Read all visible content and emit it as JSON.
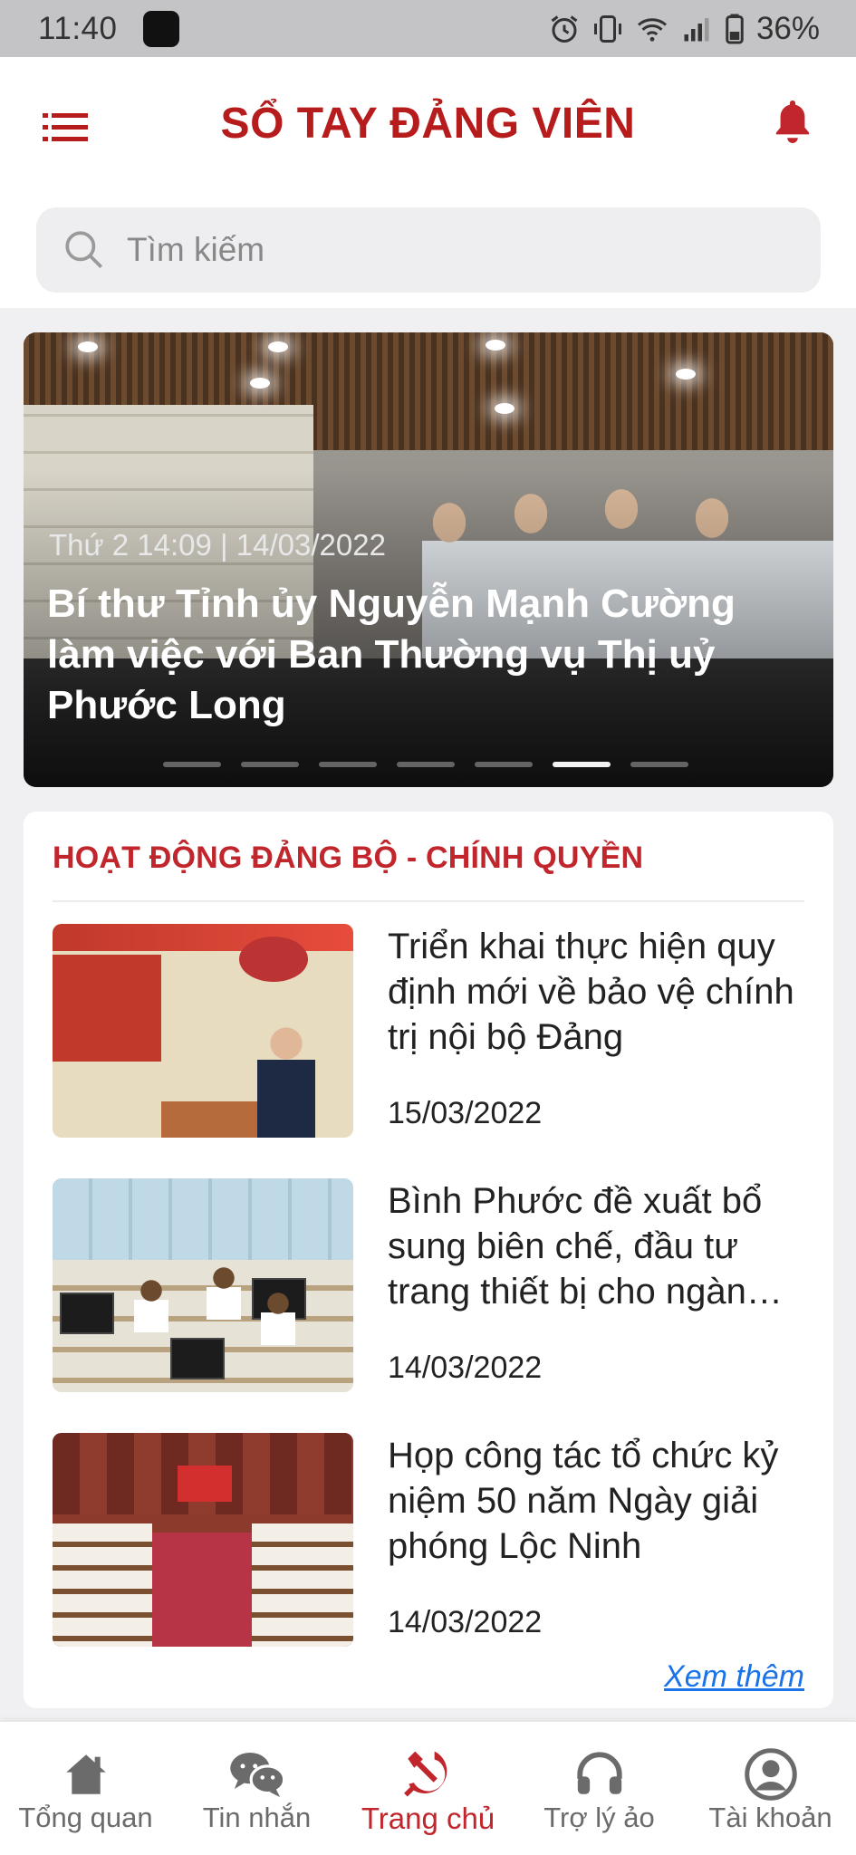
{
  "status_bar": {
    "time": "11:40",
    "battery": "36%",
    "icons": [
      "app-icon",
      "alarm-icon",
      "vibrate-icon",
      "wifi-icon",
      "signal-icon",
      "battery-icon"
    ]
  },
  "header": {
    "title": "SỔ TAY ĐẢNG VIÊN",
    "menu_icon": "menu-icon",
    "notification_icon": "bell-icon"
  },
  "search": {
    "placeholder": "Tìm kiếm",
    "value": ""
  },
  "hero": {
    "date": "Thứ 2  14:09 | 14/03/2022",
    "title": "Bí thư Tỉnh ủy Nguyễn Mạnh Cường làm việc với Ban Thường vụ Thị uỷ Phước Long",
    "slide_count": 7,
    "active_slide_index": 5
  },
  "section": {
    "title": "HOẠT ĐỘNG ĐẢNG BỘ - CHÍNH QUYỀN",
    "more_label": "Xem thêm",
    "articles": [
      {
        "title": "Triển khai thực hiện quy định mới về bảo vệ chính trị nội bộ Đảng",
        "date": "15/03/2022"
      },
      {
        "title": "Bình Phước đề xuất bổ sung biên chế, đầu tư trang thiết bị cho ngàn…",
        "date": "14/03/2022"
      },
      {
        "title": "Họp công tác tổ chức kỷ niệm 50 năm Ngày giải phóng Lộc Ninh",
        "date": "14/03/2022"
      }
    ]
  },
  "bottom_nav": {
    "active": "Trang chủ",
    "items": [
      {
        "label": "Tổng quan",
        "icon": "home-icon"
      },
      {
        "label": "Tin nhắn",
        "icon": "chat-icon"
      },
      {
        "label": "Trang chủ",
        "icon": "hammer-sickle-icon"
      },
      {
        "label": "Trợ lý ảo",
        "icon": "headphones-icon"
      },
      {
        "label": "Tài khoản",
        "icon": "account-icon"
      }
    ]
  },
  "colors": {
    "brand_red": "#b71c1c",
    "section_red": "#c0262c",
    "link_blue": "#1a73e8",
    "status_bar_bg": "#c4c4c6"
  }
}
